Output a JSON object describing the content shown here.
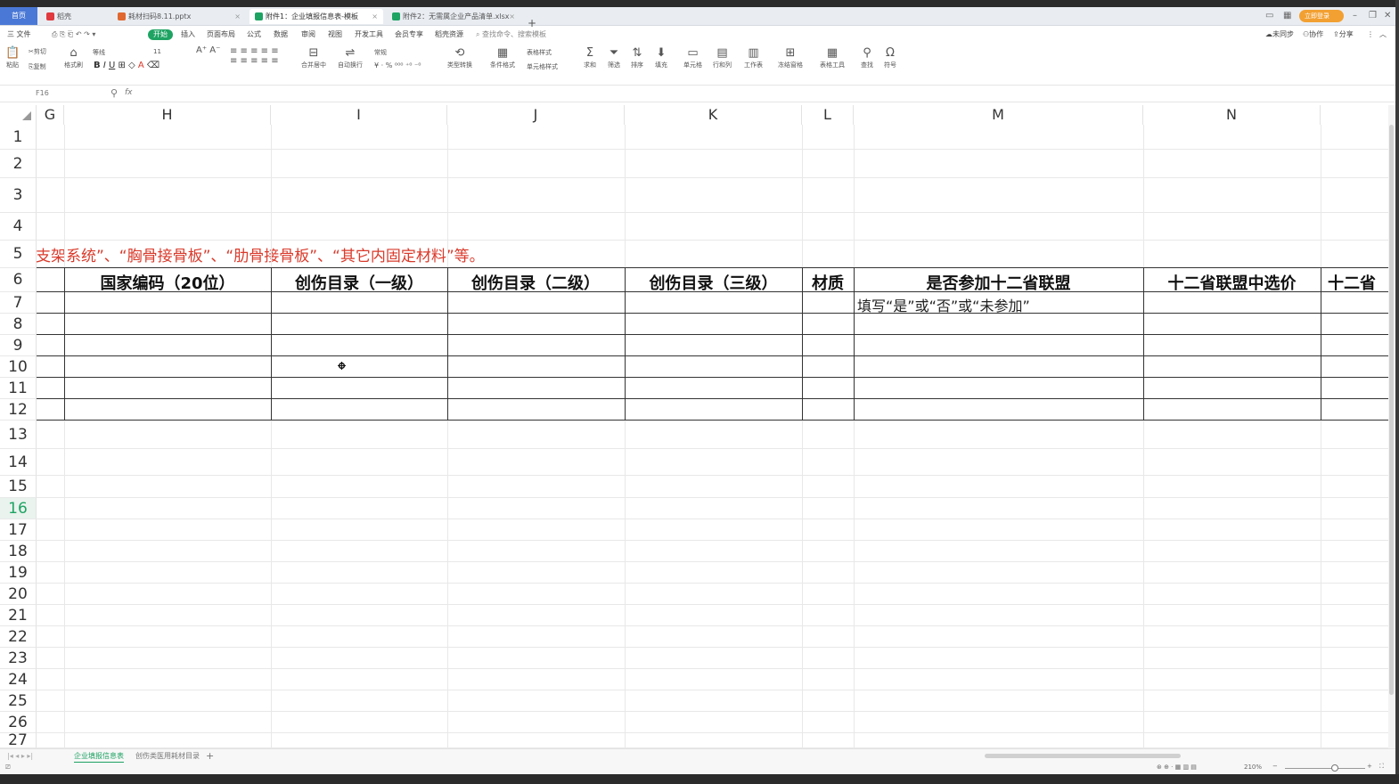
{
  "tabs": {
    "home": "首页",
    "t1": "稻壳",
    "t2": "耗材扫码8.11.pptx",
    "t3": "附件1：企业填报信息表-模板",
    "t4": "附件2：无需属企业产品清单.xlsx",
    "add": "+"
  },
  "window": {
    "login": "立即登录"
  },
  "menu": {
    "file": "三 文件",
    "start": "开始",
    "insert": "插入",
    "layout": "页面布局",
    "formula": "公式",
    "data": "数据",
    "review": "审阅",
    "view": "视图",
    "dev": "开发工具",
    "member": "会员专享",
    "docer": "稻壳资源",
    "search": "查找命令、搜索模板",
    "unsync": "未同步",
    "collab": "协作",
    "share": "分享"
  },
  "ribbon": {
    "paste": "粘贴",
    "cut": "剪切",
    "copy": "复制",
    "format_painter": "格式刷",
    "font": "等线",
    "size": "11",
    "merge": "合并居中",
    "wrap": "自动换行",
    "numfmt": "常规",
    "convert": "类型转换",
    "cond": "条件格式",
    "table_style": "表格样式",
    "cell_style": "单元格样式",
    "sum": "求和",
    "filter": "筛选",
    "sort": "排序",
    "fill": "填充",
    "cell": "单元格",
    "rowcol": "行和列",
    "sheet": "工作表",
    "freeze": "冻结窗格",
    "tools": "表格工具",
    "find": "查找",
    "symbol": "符号"
  },
  "formula_bar": {
    "cell_ref": "F16",
    "fx": "fx",
    "value": ""
  },
  "columns": [
    "G",
    "H",
    "I",
    "J",
    "K",
    "L",
    "M",
    "N"
  ],
  "rows": [
    "1",
    "2",
    "3",
    "4",
    "5",
    "6",
    "7",
    "8",
    "9",
    "10",
    "11",
    "12",
    "13",
    "14",
    "15",
    "16",
    "17",
    "18",
    "19",
    "20",
    "21",
    "22",
    "23",
    "24",
    "25",
    "26",
    "27"
  ],
  "selected_row": "16",
  "cells": {
    "row5_text": "支架系统”、“胸骨接骨板”、“肋骨接骨板”、“其它内固定材料”等。",
    "h6": "国家编码（20位）",
    "i6": "创伤目录（一级）",
    "j6": "创伤目录（二级）",
    "k6": "创伤目录（三级）",
    "l6": "材质",
    "m6": "是否参加十二省联盟",
    "n6": "十二省联盟中选价",
    "o6": "十二省",
    "m7": "填写“是”或“否”或“未参加”"
  },
  "sheets": {
    "active": "企业填报信息表",
    "other": "创伤类医用耗材目录",
    "add": "+"
  },
  "status": {
    "zoom": "210%"
  }
}
